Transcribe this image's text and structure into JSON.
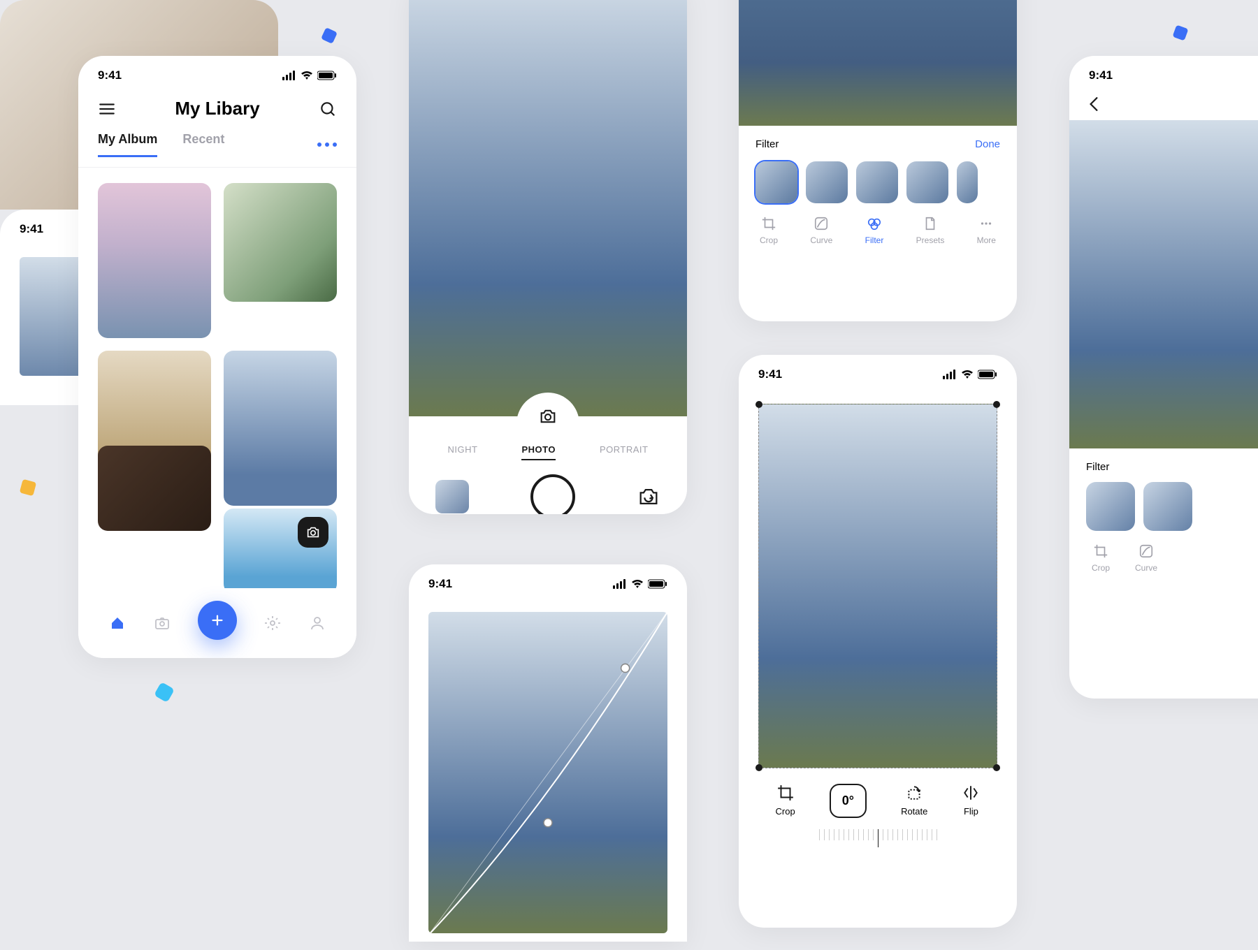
{
  "status_time": "9:41",
  "library": {
    "title": "My Libary",
    "tabs": [
      "My Album",
      "Recent"
    ],
    "active_tab": 0
  },
  "camera": {
    "modes": [
      "NIGHT",
      "PHOTO",
      "PORTRAIT"
    ],
    "active_mode": 1
  },
  "filter": {
    "label": "Filter",
    "done": "Done",
    "tools": [
      "Crop",
      "Curve",
      "Filter",
      "Presets",
      "More"
    ],
    "active_tool": 2
  },
  "crop": {
    "tools": [
      "Crop",
      "Rotate",
      "Flip"
    ],
    "rotation": "0°"
  },
  "panel5": {
    "label": "Filter",
    "tools": [
      "Crop",
      "Curve"
    ]
  },
  "colors": {
    "accent": "#3a6ef6"
  }
}
